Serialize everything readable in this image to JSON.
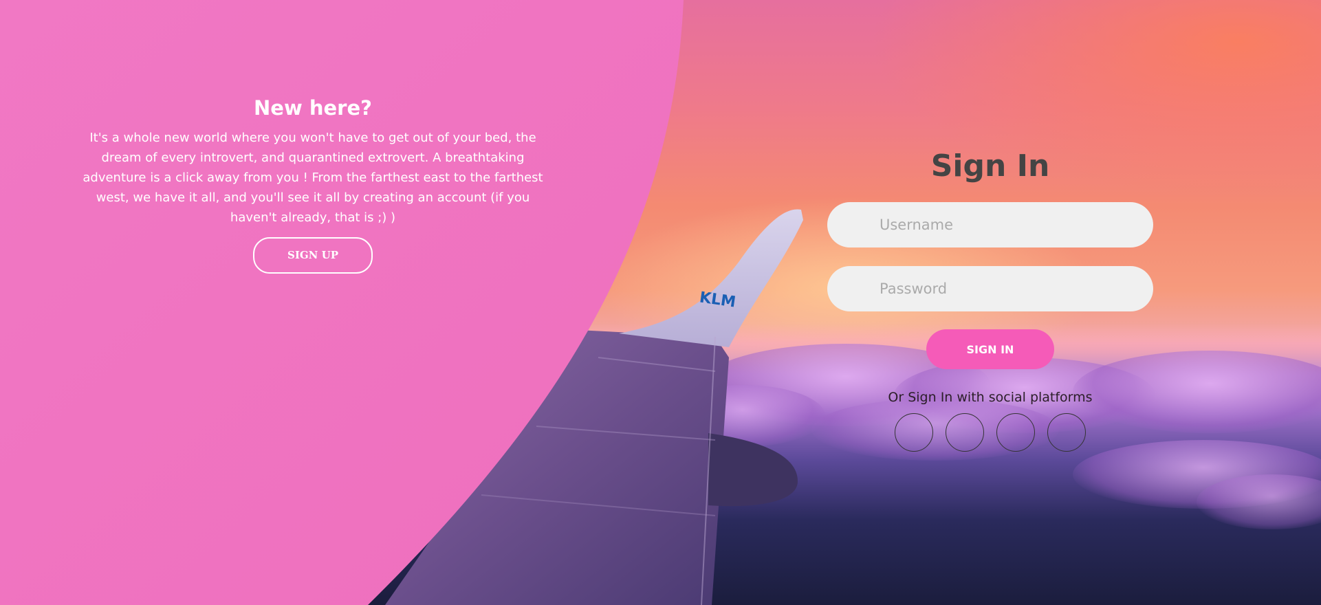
{
  "left_panel": {
    "title": "New here?",
    "description": "It's a whole new world where you won't have to get out of your bed, the dream of every introvert, and quarantined extrovert. A breathtaking adventure is a click away from you ! From the farthest east to the farthest west, we have it all, and you'll see it all by creating an account (if you haven't already, that is ;) )",
    "signup_label": "SIGN UP"
  },
  "signin_form": {
    "title": "Sign In",
    "username_placeholder": "Username",
    "username_value": "",
    "password_placeholder": "Password",
    "password_value": "",
    "submit_label": "SIGN IN",
    "social_text": "Or Sign In with social platforms",
    "social_icons": [
      "social-icon-1",
      "social-icon-2",
      "social-icon-3",
      "social-icon-4"
    ]
  },
  "background": {
    "wing_logo": "KLM"
  },
  "colors": {
    "panel_pink": "#f074c2",
    "accent_pink": "#f55bb8",
    "title_gray": "#444444",
    "input_bg": "#f0f0f0"
  }
}
